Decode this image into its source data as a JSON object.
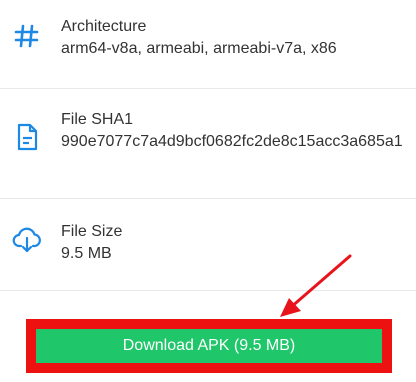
{
  "details": [
    {
      "icon": "hash-icon",
      "title": "Architecture",
      "value": "arm64-v8a, armeabi, armeabi-v7a, x86"
    },
    {
      "icon": "document-icon",
      "title": "File SHA1",
      "value": "990e7077c7a4d9bcf0682fc2de8c15acc3a685a1"
    },
    {
      "icon": "cloud-download-icon",
      "title": "File Size",
      "value": "9.5 MB"
    }
  ],
  "download": {
    "label": "Download APK (9.5 MB)"
  },
  "colors": {
    "accent": "#1e88e5",
    "button": "#1fc66a",
    "highlight": "#ee1111",
    "text": "#333333"
  }
}
